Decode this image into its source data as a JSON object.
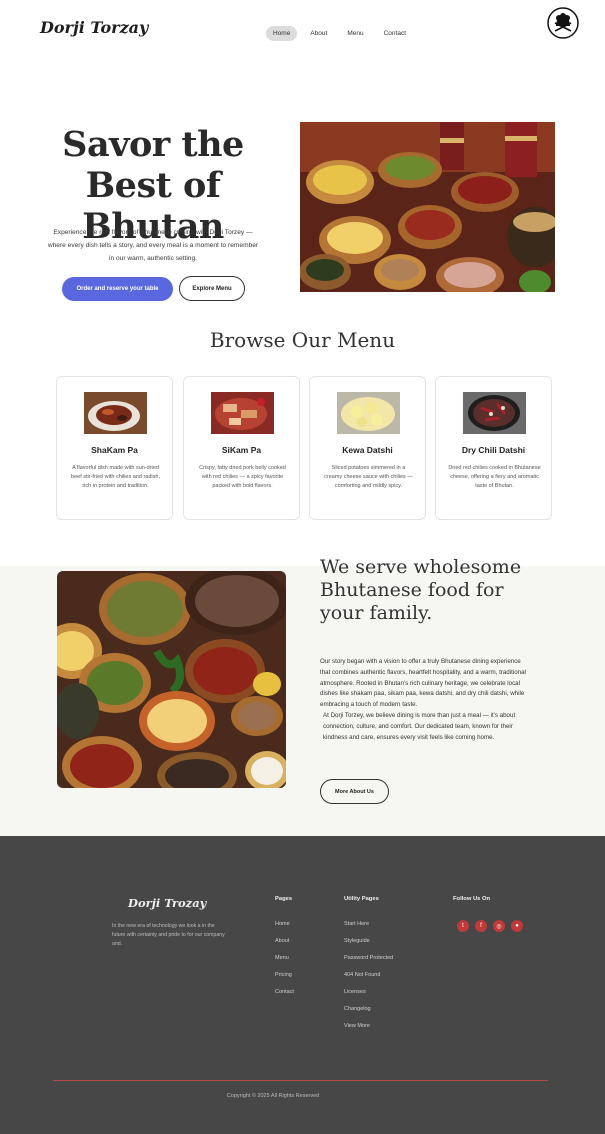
{
  "header": {
    "logo": "Dorji Torzay",
    "nav": [
      {
        "label": "Home",
        "active": true
      },
      {
        "label": "About",
        "active": false
      },
      {
        "label": "Menu",
        "active": false
      },
      {
        "label": "Contact",
        "active": false
      }
    ],
    "emblem_icon": "crest-logo-icon"
  },
  "hero": {
    "title": "Savor the Best of Bhutan",
    "description": "Experience the rich flavors of Bhutanese cuisine with Dorji Torzey — where every dish tells a story, and every meal is a moment to remember in our warm, authentic setting.",
    "primary_button": "Order and reserve your table",
    "secondary_button": "Explore Menu",
    "image": "bhutanese-food-spread-photo"
  },
  "menu": {
    "title": "Browse Our Menu",
    "items": [
      {
        "name": "ShaKam Pa",
        "description": "A flavorful dish made with sun-dried beef stir-fried with chilies and radish, rich in protein and tradition.",
        "image": "shakam-pa-photo"
      },
      {
        "name": "SiKam Pa",
        "description": "Crispy, fatty dried pork belly cooked with red chilies — a spicy favorite packed with bold flavors.",
        "image": "sikam-pa-photo"
      },
      {
        "name": "Kewa Datshi",
        "description": "Sliced potatoes simmered in a creamy cheese sauce with chilies — comforting and mildly spicy.",
        "image": "kewa-datshi-photo"
      },
      {
        "name": "Dry Chili Datshi",
        "description": "Dried red chilies cooked in Bhutanese cheese, offering a fiery and aromatic taste of Bhutan.",
        "image": "dry-chili-datshi-photo"
      }
    ]
  },
  "about": {
    "title": "We serve wholesome Bhutanese food for your family.",
    "paragraph1": "Our story began with a vision to offer a truly Bhutanese dining experience that combines authentic flavors, heartfelt hospitality, and a warm, traditional atmosphere. Rooted in Bhutan's rich culinary heritage, we celebrate local dishes like shakam paa, sikam paa, kewa datshi, and dry chili datshi, while embracing a touch of modern taste.",
    "paragraph2": "At Dorji Torzey, we believe dining is more than just a meal — it's about connection, culture, and comfort. Our dedicated team, known for their kindness and care, ensures every visit feels like coming home.",
    "button": "More About Us",
    "image": "bhutanese-dishes-bowls-photo"
  },
  "footer": {
    "logo": "Dorji Trozay",
    "tagline": "In the new era of technology we look a in the future with certainty and pride to for our company and.",
    "pages_heading": "Pages",
    "pages": [
      "Home",
      "About",
      "Menu",
      "Pricing",
      "Contact"
    ],
    "utility_heading": "Utility Pages",
    "utility": [
      "Start Here",
      "Styleguide",
      "Password Protected",
      "404 Not Found",
      "Licenses",
      "Changelog",
      "View More"
    ],
    "follow_heading": "Follow Us On",
    "socials": [
      {
        "icon": "twitter-icon",
        "glyph": "t"
      },
      {
        "icon": "facebook-icon",
        "glyph": "f"
      },
      {
        "icon": "instagram-icon",
        "glyph": "◎"
      },
      {
        "icon": "github-icon",
        "glyph": "●"
      }
    ],
    "copyright": "Copyright © 2025 All Rights Reserved"
  },
  "colors": {
    "accent": "#5a68e0",
    "footer_bg": "#474747",
    "social_red": "#c0393b",
    "about_bg": "#f6f6f3"
  }
}
